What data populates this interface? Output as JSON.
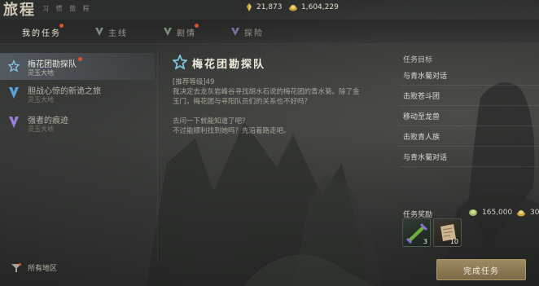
{
  "header": {
    "title": "旅程",
    "subtitle": "习 惯 旅 程",
    "currencies": [
      {
        "icon": "silver-coin-icon",
        "value": "21,873"
      },
      {
        "icon": "gold-ingot-icon",
        "value": "1,604,229"
      }
    ]
  },
  "tabs": [
    {
      "label": "我的任务",
      "icon": "none",
      "active": true,
      "badge": true
    },
    {
      "label": "主线",
      "icon": "main-quest-emblem-icon",
      "active": false,
      "badge": false
    },
    {
      "label": "剧情",
      "icon": "story-emblem-icon",
      "active": false,
      "badge": true
    },
    {
      "label": "探险",
      "icon": "adventure-emblem-icon",
      "active": false,
      "badge": false
    }
  ],
  "quests": [
    {
      "title": "梅花团勘探队",
      "region": "灵玉大地",
      "icon": "star-compass-icon",
      "color": "#7ec3de",
      "selected": true,
      "badge": true
    },
    {
      "title": "胆战心惊的新诡之旅",
      "region": "灵玉大地",
      "icon": "chevron-crest-icon",
      "color": "#5aa1d6",
      "selected": false,
      "badge": false
    },
    {
      "title": "强者的痕迹",
      "region": "灵玉大地",
      "icon": "chevron-crest-icon",
      "color": "#9a7fd9",
      "selected": false,
      "badge": false
    }
  ],
  "filter": {
    "label": "所有地区",
    "icon": "filter-funnel-icon"
  },
  "detail": {
    "title": "梅花团勘探队",
    "lines": [
      "[推荐等级]49",
      "我决定去龙灰岩峰谷寻找胡水石说的梅花团的青水菊。除了金",
      "玉门，梅花团与寻阳队员们的关系也不好吗？",
      "",
      "去问一下就能知道了吧？",
      "不过能顺利找到她吗？先沿着路走吧。"
    ]
  },
  "objectives": {
    "header": "任务目标",
    "items": [
      "与青水菊对话",
      "击败苍斗团",
      "移动至龙兽",
      "击败青人族",
      "与青水菊对话"
    ]
  },
  "rewards": {
    "label": "任务奖励",
    "money": [
      {
        "icon": "silver-coin-icon",
        "value": "165,000"
      },
      {
        "icon": "gold-ingot-icon",
        "value": "30"
      }
    ],
    "items": [
      {
        "icon": "green-scroll-icon",
        "count": "3"
      },
      {
        "icon": "parchment-icon",
        "count": "10"
      }
    ]
  },
  "complete_button": {
    "label": "完成任务"
  },
  "colors": {
    "accent": "#d9542d",
    "button": "#8f7c55",
    "selected_row": "#5f6670"
  }
}
